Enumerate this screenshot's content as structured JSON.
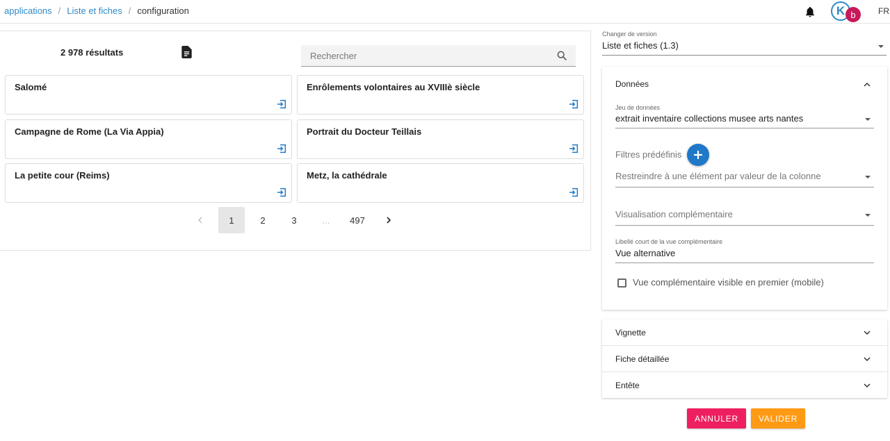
{
  "breadcrumb": {
    "items": [
      "applications",
      "Liste et fiches"
    ],
    "current": "configuration"
  },
  "header": {
    "avatar_letter": "K",
    "badge_letter": "b",
    "language": "FR"
  },
  "list": {
    "results_count": "2 978 résultats",
    "search_placeholder": "Rechercher",
    "cards": [
      {
        "title": "Salomé"
      },
      {
        "title": "Enrôlements volontaires au XVIIIè siècle"
      },
      {
        "title": "Campagne de Rome (La Via Appia)"
      },
      {
        "title": "Portrait du Docteur Teillais"
      },
      {
        "title": "La petite cour (Reims)"
      },
      {
        "title": "Metz, la cathédrale"
      }
    ],
    "pagination": {
      "pages": [
        "1",
        "2",
        "3",
        "...",
        "497"
      ],
      "current": "1"
    }
  },
  "config": {
    "version_label": "Changer de version",
    "version_value": "Liste et fiches (1.3)",
    "donnees": {
      "title": "Données",
      "dataset_label": "Jeu de données",
      "dataset_value": "extrait inventaire collections musee arts nantes",
      "filters_label": "Filtres prédéfinis",
      "restrict_placeholder": "Restreindre à une élément par valeur de la colonne",
      "visualisation_placeholder": "Visualisation complémentaire",
      "short_label_label": "Libellé court de la vue complémentaire",
      "short_label_value": "Vue alternative",
      "mobile_checkbox_label": "Vue complémentaire visible en premier (mobile)"
    },
    "sections": [
      "Vignette",
      "Fiche détaillée",
      "Entête"
    ],
    "buttons": {
      "cancel": "ANNULER",
      "validate": "VALIDER"
    }
  },
  "colors": {
    "link": "#2f8ac9",
    "primary": "#1f78c8",
    "cancel": "#ee1f60",
    "validate": "#ff9a14",
    "badge": "#c8195a"
  }
}
